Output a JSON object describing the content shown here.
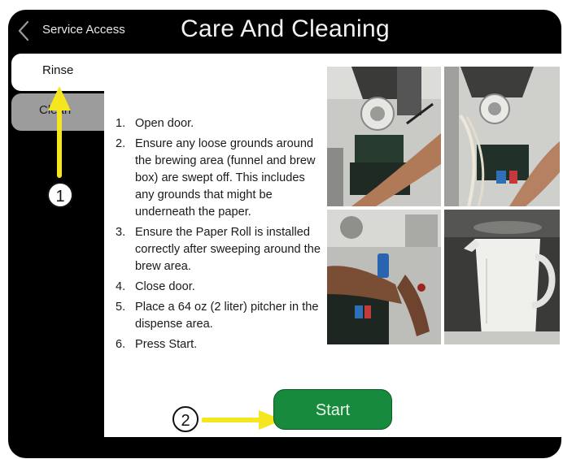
{
  "header": {
    "back_label": "Service Access",
    "title": "Care And Cleaning"
  },
  "tabs": [
    {
      "label": "Rinse",
      "selected": true
    },
    {
      "label": "Clean",
      "selected": false
    }
  ],
  "instructions": [
    {
      "num": "1.",
      "text": "Open door."
    },
    {
      "num": "2.",
      "text": "Ensure any loose grounds around the brewing area (funnel and brew box) are swept off. This includes any grounds that might be underneath the paper."
    },
    {
      "num": "3.",
      "text": "Ensure the Paper Roll is installed correctly after sweeping around the brew area."
    },
    {
      "num": "4.",
      "text": "Close door."
    },
    {
      "num": "5.",
      "text": "Place a 64 oz (2 liter) pitcher in the dispense area."
    },
    {
      "num": "6.",
      "text": "Press Start."
    }
  ],
  "start_button": {
    "label": "Start"
  },
  "annotations": {
    "callout_1": "1",
    "callout_2": "2",
    "arrow_color": "#f5e61f"
  },
  "colors": {
    "start_green": "#178a3e",
    "selected_tab": "#ffffff",
    "unselected_tab": "#9c9c9c",
    "frame": "#000000"
  }
}
